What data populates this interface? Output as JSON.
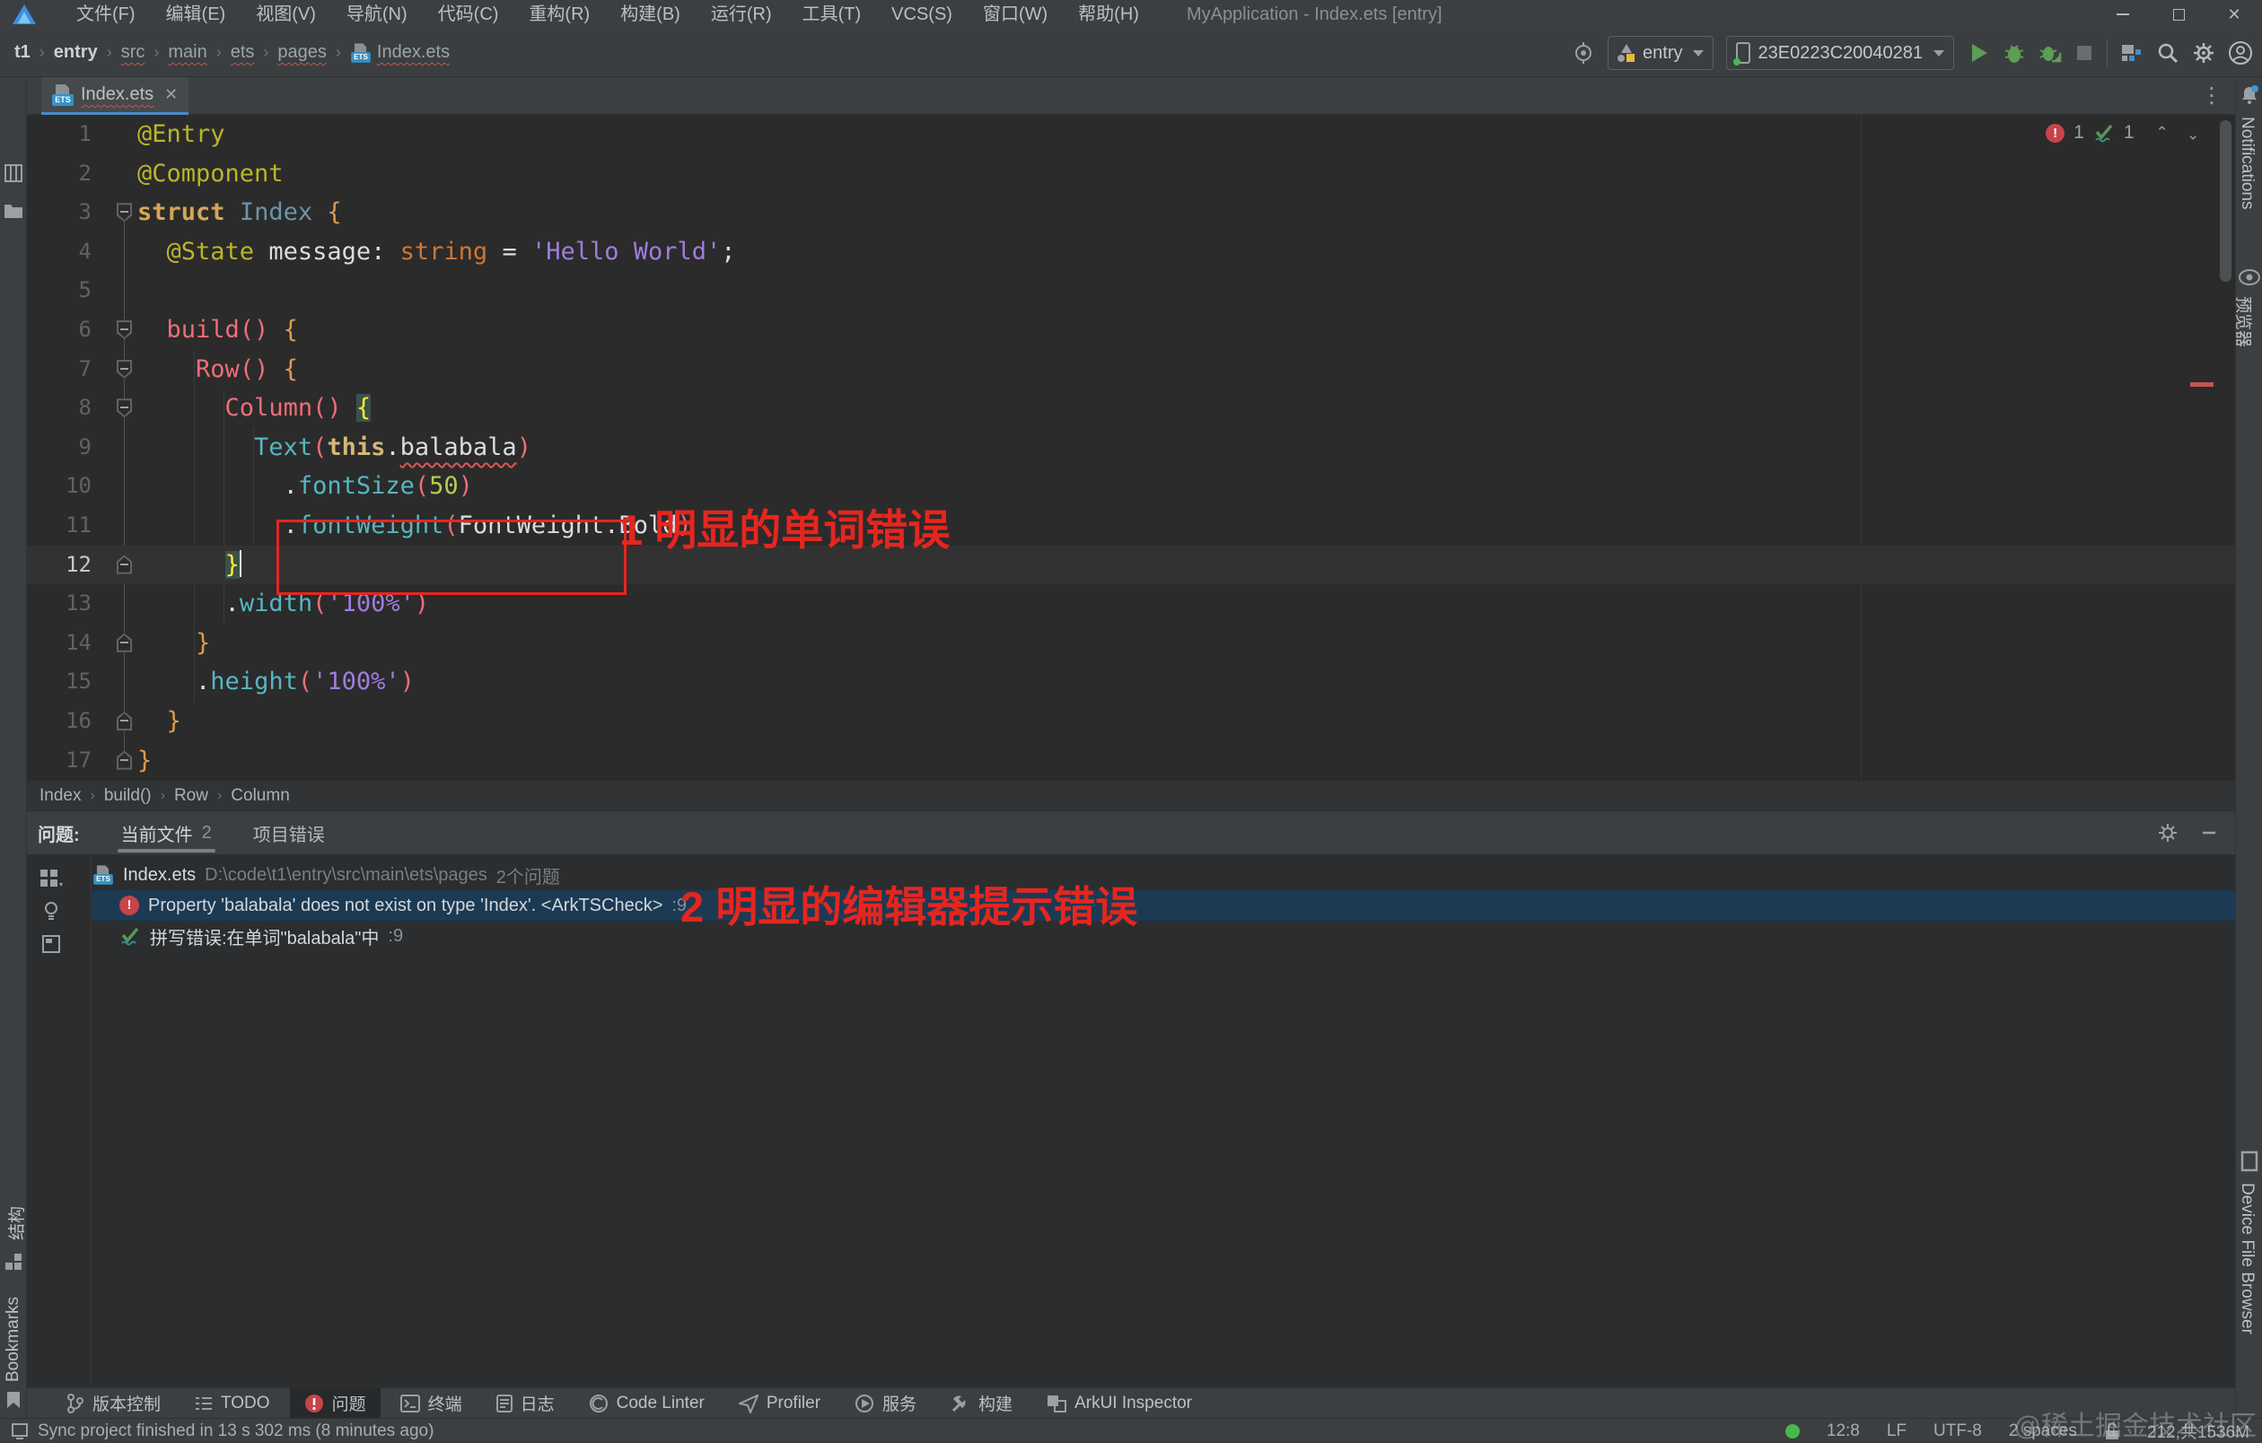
{
  "window": {
    "title": "MyApplication - Index.ets [entry]"
  },
  "menu": {
    "items": [
      "文件(F)",
      "编辑(E)",
      "视图(V)",
      "导航(N)",
      "代码(C)",
      "重构(R)",
      "构建(B)",
      "运行(R)",
      "工具(T)",
      "VCS(S)",
      "窗口(W)",
      "帮助(H)"
    ]
  },
  "navbar": {
    "breadcrumbs": [
      {
        "label": "t1",
        "bold": true
      },
      {
        "label": "entry",
        "bold": true
      },
      {
        "label": "src",
        "squiggle": true
      },
      {
        "label": "main",
        "squiggle": true
      },
      {
        "label": "ets",
        "squiggle": true
      },
      {
        "label": "pages",
        "squiggle": true
      },
      {
        "label": "Index.ets",
        "squiggle": true,
        "ets_icon": true
      }
    ],
    "module_select": "entry",
    "device_select": "23E0223C20040281"
  },
  "tabs": {
    "active_label": "Index.ets",
    "close": "✕",
    "kebab": "⋮"
  },
  "editor": {
    "inspections": {
      "errors": "1",
      "typos": "1"
    },
    "lines": [
      {
        "n": "1",
        "tokens": [
          [
            "ann",
            "@Entry"
          ]
        ]
      },
      {
        "n": "2",
        "tokens": [
          [
            "ann",
            "@Component"
          ]
        ]
      },
      {
        "n": "3",
        "fold": "open",
        "tokens": [
          [
            "kw",
            "struct"
          ],
          [
            "pl",
            " "
          ],
          [
            "ty",
            "Index"
          ],
          [
            "pl",
            " "
          ],
          [
            "br",
            "{"
          ]
        ]
      },
      {
        "n": "4",
        "tokens": [
          [
            "pl",
            "  "
          ],
          [
            "ann",
            "@State"
          ],
          [
            "pl",
            " "
          ],
          [
            "pl",
            "message"
          ],
          [
            "pl",
            ": "
          ],
          [
            "skw",
            "string"
          ],
          [
            "pl",
            " = "
          ],
          [
            "st",
            "'Hello World'"
          ],
          [
            "pl",
            ";"
          ]
        ]
      },
      {
        "n": "5",
        "tokens": []
      },
      {
        "n": "6",
        "fold": "open",
        "tokens": [
          [
            "pl",
            "  "
          ],
          [
            "cm",
            "build"
          ],
          [
            "pn",
            "()"
          ],
          [
            "pl",
            " "
          ],
          [
            "br",
            "{"
          ]
        ]
      },
      {
        "n": "7",
        "fold": "open",
        "tokens": [
          [
            "pl",
            "    "
          ],
          [
            "cm",
            "Row"
          ],
          [
            "pn",
            "()"
          ],
          [
            "pl",
            " "
          ],
          [
            "br",
            "{"
          ]
        ]
      },
      {
        "n": "8",
        "fold": "open",
        "tokens": [
          [
            "pl",
            "      "
          ],
          [
            "cm",
            "Column"
          ],
          [
            "pn",
            "()"
          ],
          [
            "pl",
            " "
          ],
          [
            "mb",
            "{"
          ]
        ]
      },
      {
        "n": "9",
        "tokens": [
          [
            "pl",
            "        "
          ],
          [
            "mt",
            "Text"
          ],
          [
            "pn",
            "("
          ],
          [
            "th",
            "this"
          ],
          [
            "pl",
            "."
          ],
          [
            "er",
            "balabala"
          ],
          [
            "pn",
            ")"
          ]
        ]
      },
      {
        "n": "10",
        "tokens": [
          [
            "pl",
            "          "
          ],
          [
            "pl",
            "."
          ],
          [
            "mt",
            "fontSize"
          ],
          [
            "pn",
            "("
          ],
          [
            "nm",
            "50"
          ],
          [
            "pn",
            ")"
          ]
        ]
      },
      {
        "n": "11",
        "tokens": [
          [
            "pl",
            "          "
          ],
          [
            "pl",
            "."
          ],
          [
            "mt",
            "fontWeight"
          ],
          [
            "pn",
            "("
          ],
          [
            "pl",
            "FontWeight.Bold"
          ],
          [
            "pn",
            ")"
          ]
        ]
      },
      {
        "n": "12",
        "fold": "close",
        "current": true,
        "caret": true,
        "tokens": [
          [
            "pl",
            "      "
          ],
          [
            "mb",
            "}"
          ]
        ]
      },
      {
        "n": "13",
        "tokens": [
          [
            "pl",
            "      "
          ],
          [
            "pl",
            "."
          ],
          [
            "mt",
            "width"
          ],
          [
            "pn",
            "("
          ],
          [
            "st",
            "'100%'"
          ],
          [
            "pn",
            ")"
          ]
        ]
      },
      {
        "n": "14",
        "fold": "close",
        "tokens": [
          [
            "pl",
            "    "
          ],
          [
            "br",
            "}"
          ]
        ]
      },
      {
        "n": "15",
        "tokens": [
          [
            "pl",
            "    "
          ],
          [
            "pl",
            "."
          ],
          [
            "mt",
            "height"
          ],
          [
            "pn",
            "("
          ],
          [
            "st",
            "'100%'"
          ],
          [
            "pn",
            ")"
          ]
        ]
      },
      {
        "n": "16",
        "fold": "close",
        "tokens": [
          [
            "pl",
            "  "
          ],
          [
            "br",
            "}"
          ]
        ]
      },
      {
        "n": "17",
        "fold": "close",
        "tokens": [
          [
            "br",
            "}"
          ]
        ]
      }
    ],
    "annotation_1": "1 明显的单词错误",
    "breadcrumb": [
      "Index",
      "build()",
      "Row",
      "Column"
    ]
  },
  "problems": {
    "label": "问题:",
    "tab_current_file": "当前文件",
    "tab_current_count": "2",
    "tab_project_errors": "项目错误",
    "file_row": {
      "file": "Index.ets",
      "path": "D:\\code\\t1\\entry\\src\\main\\ets\\pages",
      "badge": "2个问题"
    },
    "error_row": {
      "text": "Property 'balabala' does not exist on type 'Index'. <ArkTSCheck>",
      "loc": ":9"
    },
    "typo_row": {
      "text": "拼写错误:在单词\"balabala\"中",
      "loc": ":9"
    },
    "annotation_2": "2 明显的编辑器提示错误"
  },
  "bottom_toolbar": {
    "items": [
      {
        "icon": "vcs",
        "label": "版本控制"
      },
      {
        "icon": "todo",
        "label": "TODO"
      },
      {
        "icon": "problems",
        "label": "问题",
        "active": true
      },
      {
        "icon": "terminal",
        "label": "终端"
      },
      {
        "icon": "log",
        "label": "日志"
      },
      {
        "icon": "linter",
        "label": "Code Linter"
      },
      {
        "icon": "profiler",
        "label": "Profiler"
      },
      {
        "icon": "services",
        "label": "服务"
      },
      {
        "icon": "build",
        "label": "构建"
      },
      {
        "icon": "arkui",
        "label": "ArkUI Inspector"
      }
    ]
  },
  "statusbar": {
    "sync": "Sync project finished in 13 s 302 ms (8 minutes ago)",
    "caret_pos": "12:8",
    "line_sep": "LF",
    "encoding": "UTF-8",
    "indent": "2 spaces",
    "memory": "212,共1536M"
  },
  "watermark": "@稀土掘金技术社区",
  "side": {
    "left": {
      "structure": "结构",
      "bookmarks": "Bookmarks"
    },
    "right": {
      "notifications": "Notifications",
      "previewer": "预览器",
      "device_file_browser": "Device File Browser"
    }
  }
}
